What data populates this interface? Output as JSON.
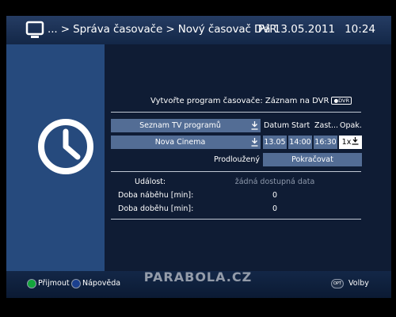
{
  "header": {
    "breadcrumb": "... > Správa časovače > Nový časovač DVR",
    "date": "Pá 13.05.2011",
    "time": "10:24"
  },
  "main": {
    "title_text": "Vytvořte program časovače: Záznam na DVR",
    "title_badge": "DVR",
    "channel_list_label": "Seznam TV programů",
    "channel_name": "Nova Cinema",
    "columns": {
      "date": "Datum",
      "start": "Start",
      "stop": "Zast...",
      "repeat": "Opak."
    },
    "row": {
      "date": "13.05",
      "start": "14:00",
      "stop": "16:30",
      "repeat": "1x"
    },
    "extended_label": "Prodloužený",
    "continue_label": "Pokračovat",
    "details": [
      {
        "label": "Událost:",
        "value": "žádná dostupná data"
      },
      {
        "label": "Doba náběhu [min]:",
        "value": "0"
      },
      {
        "label": "Doba doběhu [min]:",
        "value": "0"
      }
    ]
  },
  "footer": {
    "green_label": "Přijmout",
    "blue_label": "Nápověda",
    "opt_icon_text": "OPT",
    "options_label": "Volby",
    "watermark": "PARABOLA.CZ"
  },
  "colors": {
    "header_bg": "#1b3156",
    "left_panel_bg": "#264a7d",
    "main_bg": "#0f1c34",
    "field_bg": "#536d95",
    "green_button": "#13a53b",
    "blue_button": "#1a3f8f"
  }
}
